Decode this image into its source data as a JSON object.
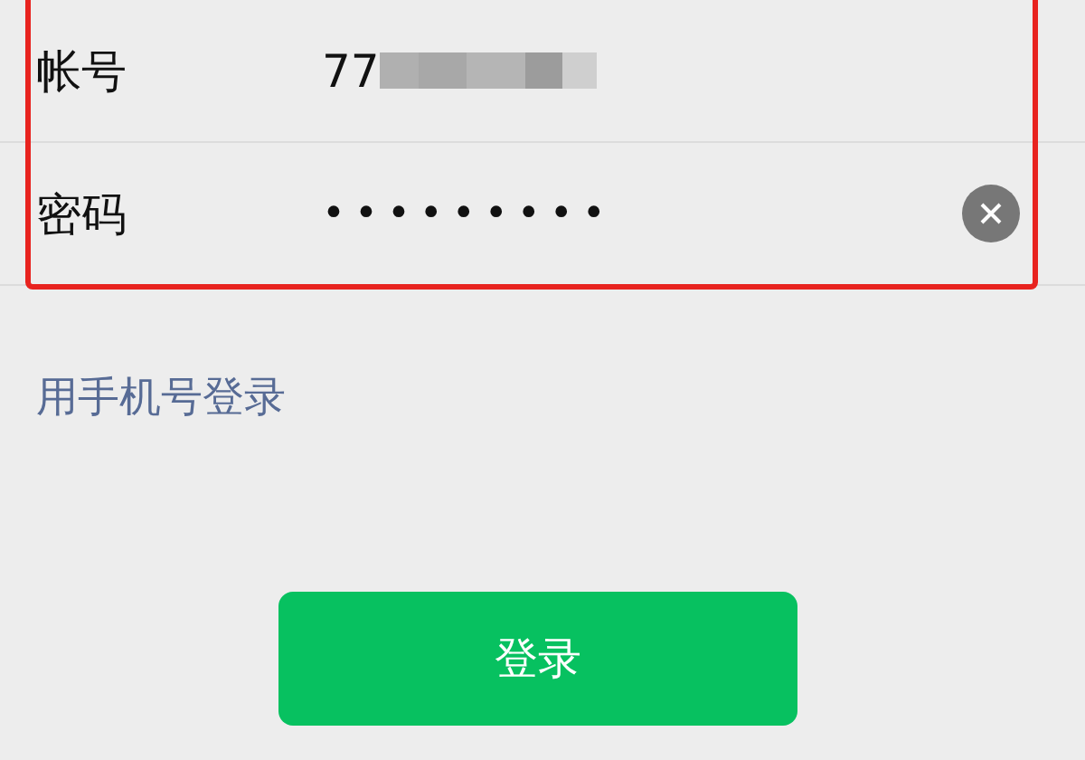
{
  "form": {
    "rows": [
      {
        "kind": "account",
        "label": "帐号",
        "value": "77",
        "redacted": true
      },
      {
        "kind": "password",
        "label": "密码",
        "value": "•••••••••",
        "clear_button": true
      }
    ],
    "highlighted": true
  },
  "phone_login_link": "用手机号登录",
  "login_button": "登录"
}
